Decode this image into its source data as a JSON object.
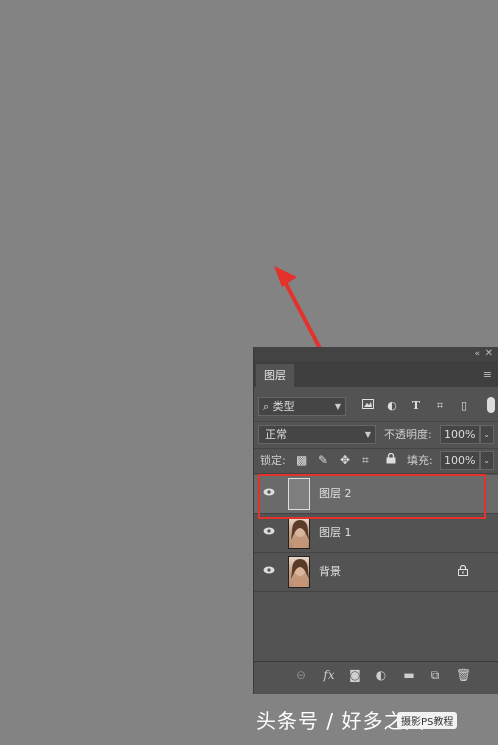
{
  "colors": {
    "canvas_bg": "#838383",
    "panel_bg": "#535353",
    "selected_row": "#6a6a6a",
    "arrow_red": "#e4312b"
  },
  "panel": {
    "collapse_icon": "«",
    "close_icon": "✕",
    "tab_label": "图层",
    "menu_icon": "≡"
  },
  "filter": {
    "search_icon": "⌕",
    "kind_label": "类型",
    "icons": [
      "image-filter-icon",
      "adjustment-filter-icon",
      "type-filter-icon",
      "shape-filter-icon",
      "smart-object-filter-icon"
    ]
  },
  "blend": {
    "mode": "正常",
    "opacity_label": "不透明度:",
    "opacity_value": "100%"
  },
  "lock": {
    "label": "锁定:",
    "fill_label": "填充:",
    "fill_value": "100%"
  },
  "layers": [
    {
      "name": "图层 2",
      "selected": true,
      "thumb": "empty"
    },
    {
      "name": "图层 1",
      "selected": false,
      "thumb": "photo"
    },
    {
      "name": "背景",
      "selected": false,
      "thumb": "photo",
      "locked": true
    }
  ],
  "bottom_bar": {
    "fx_label": "fx"
  },
  "watermark": {
    "text": "头条号 / 好多之图",
    "badge": "摄影PS教程"
  }
}
